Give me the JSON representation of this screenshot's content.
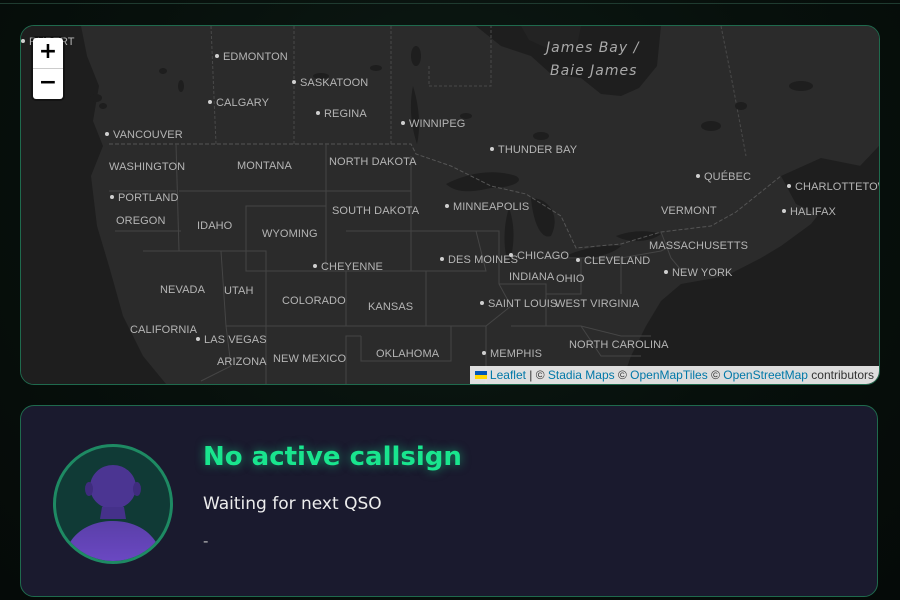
{
  "map": {
    "zoom_in_label": "+",
    "zoom_out_label": "−",
    "water_labels": [
      "James Bay /",
      "Baie James"
    ],
    "labels": [
      "RUPERT",
      "EDMONTON",
      "SASKATOON",
      "CALGARY",
      "REGINA",
      "WINNIPEG",
      "VANCOUVER",
      "THUNDER BAY",
      "WASHINGTON",
      "MONTANA",
      "NORTH DAKOTA",
      "QUÉBEC",
      "CHARLOTTETOWN",
      "PORTLAND",
      "HALIFAX",
      "VERMONT",
      "OREGON",
      "SOUTH DAKOTA",
      "MINNEAPOLIS",
      "IDAHO",
      "WYOMING",
      "MASSACHUSETTS",
      "CHICAGO",
      "DES MOINES",
      "CLEVELAND",
      "CHEYENNE",
      "NEW YORK",
      "INDIANA",
      "OHIO",
      "NEVADA",
      "UTAH",
      "COLORADO",
      "KANSAS",
      "SAINT LOUIS",
      "WEST VIRGINIA",
      "CALIFORNIA",
      "LAS VEGAS",
      "NORTH CAROLINA",
      "OKLAHOMA",
      "MEMPHIS",
      "ARIZONA",
      "NEW MEXICO"
    ],
    "attribution": {
      "leaflet": "Leaflet",
      "sep1": " | © ",
      "stadia": "Stadia Maps",
      "sep2": " © ",
      "omt": "OpenMapTiles",
      "sep3": " © ",
      "osm": "OpenStreetMap",
      "suffix": " contributors"
    },
    "colors": {
      "land": "#2b2b2b",
      "water": "#1e1e1e",
      "border": "#4a4a4a",
      "label": "#b5b5b5"
    }
  },
  "card": {
    "callsign": "No active callsign",
    "status": "Waiting for next QSO",
    "detail": "-",
    "avatar_icon": "user-silhouette-icon",
    "colors": {
      "accent": "#19e58e",
      "background": "#1a1a2e",
      "border": "#1f6a4d"
    }
  }
}
